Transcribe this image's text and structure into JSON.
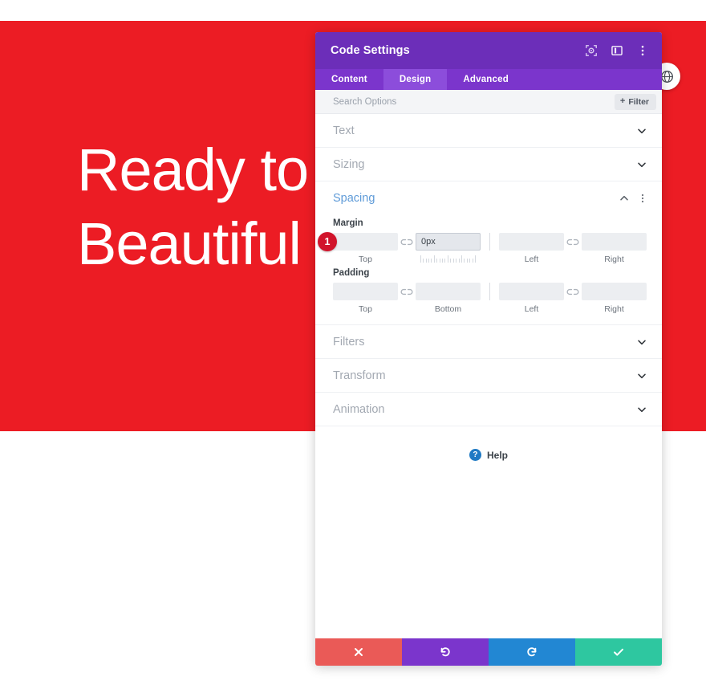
{
  "hero": {
    "line1": "Ready to",
    "line2": "Beautiful",
    "bg_color": "#ec1c24",
    "text_color": "#ffffff"
  },
  "round_button": {
    "icon": "globe-icon"
  },
  "panel": {
    "title": "Code Settings",
    "accent_color": "#6c2eb9",
    "header_icons": [
      {
        "name": "focus-icon",
        "label": "Focus"
      },
      {
        "name": "layout-panel-icon",
        "label": "Layout"
      },
      {
        "name": "more-vertical-icon",
        "label": "More"
      }
    ],
    "tabs": [
      {
        "label": "Content",
        "active": false
      },
      {
        "label": "Design",
        "active": true
      },
      {
        "label": "Advanced",
        "active": false
      }
    ],
    "search": {
      "placeholder": "Search Options",
      "value": "",
      "filter_label": "Filter",
      "filter_plus": "+"
    },
    "sections": [
      {
        "label": "Text",
        "open": false
      },
      {
        "label": "Sizing",
        "open": false
      }
    ],
    "sections_after": [
      {
        "label": "Filters",
        "open": false
      },
      {
        "label": "Transform",
        "open": false
      },
      {
        "label": "Animation",
        "open": false
      }
    ],
    "spacing": {
      "label": "Spacing",
      "open": true,
      "margin": {
        "label": "Margin",
        "fields": [
          {
            "sub": "Top",
            "value": "",
            "focused": false,
            "ruler": false
          },
          {
            "sub": "",
            "value": "0px",
            "focused": true,
            "ruler": true
          },
          {
            "sub": "Left",
            "value": "",
            "focused": false,
            "ruler": false
          },
          {
            "sub": "Right",
            "value": "",
            "focused": false,
            "ruler": false
          }
        ]
      },
      "padding": {
        "label": "Padding",
        "fields": [
          {
            "sub": "Top",
            "value": "",
            "focused": false,
            "ruler": false
          },
          {
            "sub": "Bottom",
            "value": "",
            "focused": false,
            "ruler": false
          },
          {
            "sub": "Left",
            "value": "",
            "focused": false,
            "ruler": false
          },
          {
            "sub": "Right",
            "value": "",
            "focused": false,
            "ruler": false
          }
        ]
      }
    },
    "help": {
      "label": "Help",
      "icon_char": "?"
    },
    "footer_buttons": [
      {
        "name": "cancel-button",
        "icon": "close-icon",
        "color": "#ea5a57"
      },
      {
        "name": "undo-button",
        "icon": "undo-icon",
        "color": "#7b35cc"
      },
      {
        "name": "redo-button",
        "icon": "redo-icon",
        "color": "#2287d3"
      },
      {
        "name": "save-button",
        "icon": "check-icon",
        "color": "#2ec7a0"
      }
    ]
  },
  "marker": {
    "number": "1"
  }
}
